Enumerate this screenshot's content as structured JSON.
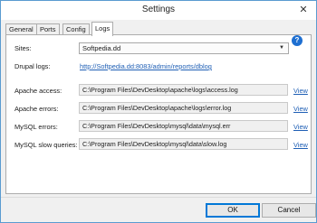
{
  "window": {
    "title": "Settings",
    "close_glyph": "✕"
  },
  "tabs": [
    {
      "label": "General"
    },
    {
      "label": "Ports"
    },
    {
      "label": "Config"
    },
    {
      "label": "Logs",
      "active": true
    }
  ],
  "help": {
    "glyph": "?"
  },
  "sites": {
    "label": "Sites:",
    "value": "Softpedia.dd"
  },
  "drupal_logs": {
    "label": "Drupal logs:",
    "url": "http://Softpedia.dd:8083/admin/reports/dblog"
  },
  "logs": [
    {
      "label": "Apache access:",
      "path": "C:\\Program Files\\DevDesktop\\apache\\logs\\access.log",
      "action": "View"
    },
    {
      "label": "Apache errors:",
      "path": "C:\\Program Files\\DevDesktop\\apache\\logs\\error.log",
      "action": "View"
    },
    {
      "label": "MySQL errors:",
      "path": "C:\\Program Files\\DevDesktop\\mysql\\data\\mysql.err",
      "action": "View"
    },
    {
      "label": "MySQL slow queries:",
      "path": "C:\\Program Files\\DevDesktop\\mysql\\data\\slow.log",
      "action": "View"
    }
  ],
  "buttons": {
    "ok": "OK",
    "cancel": "Cancel"
  }
}
